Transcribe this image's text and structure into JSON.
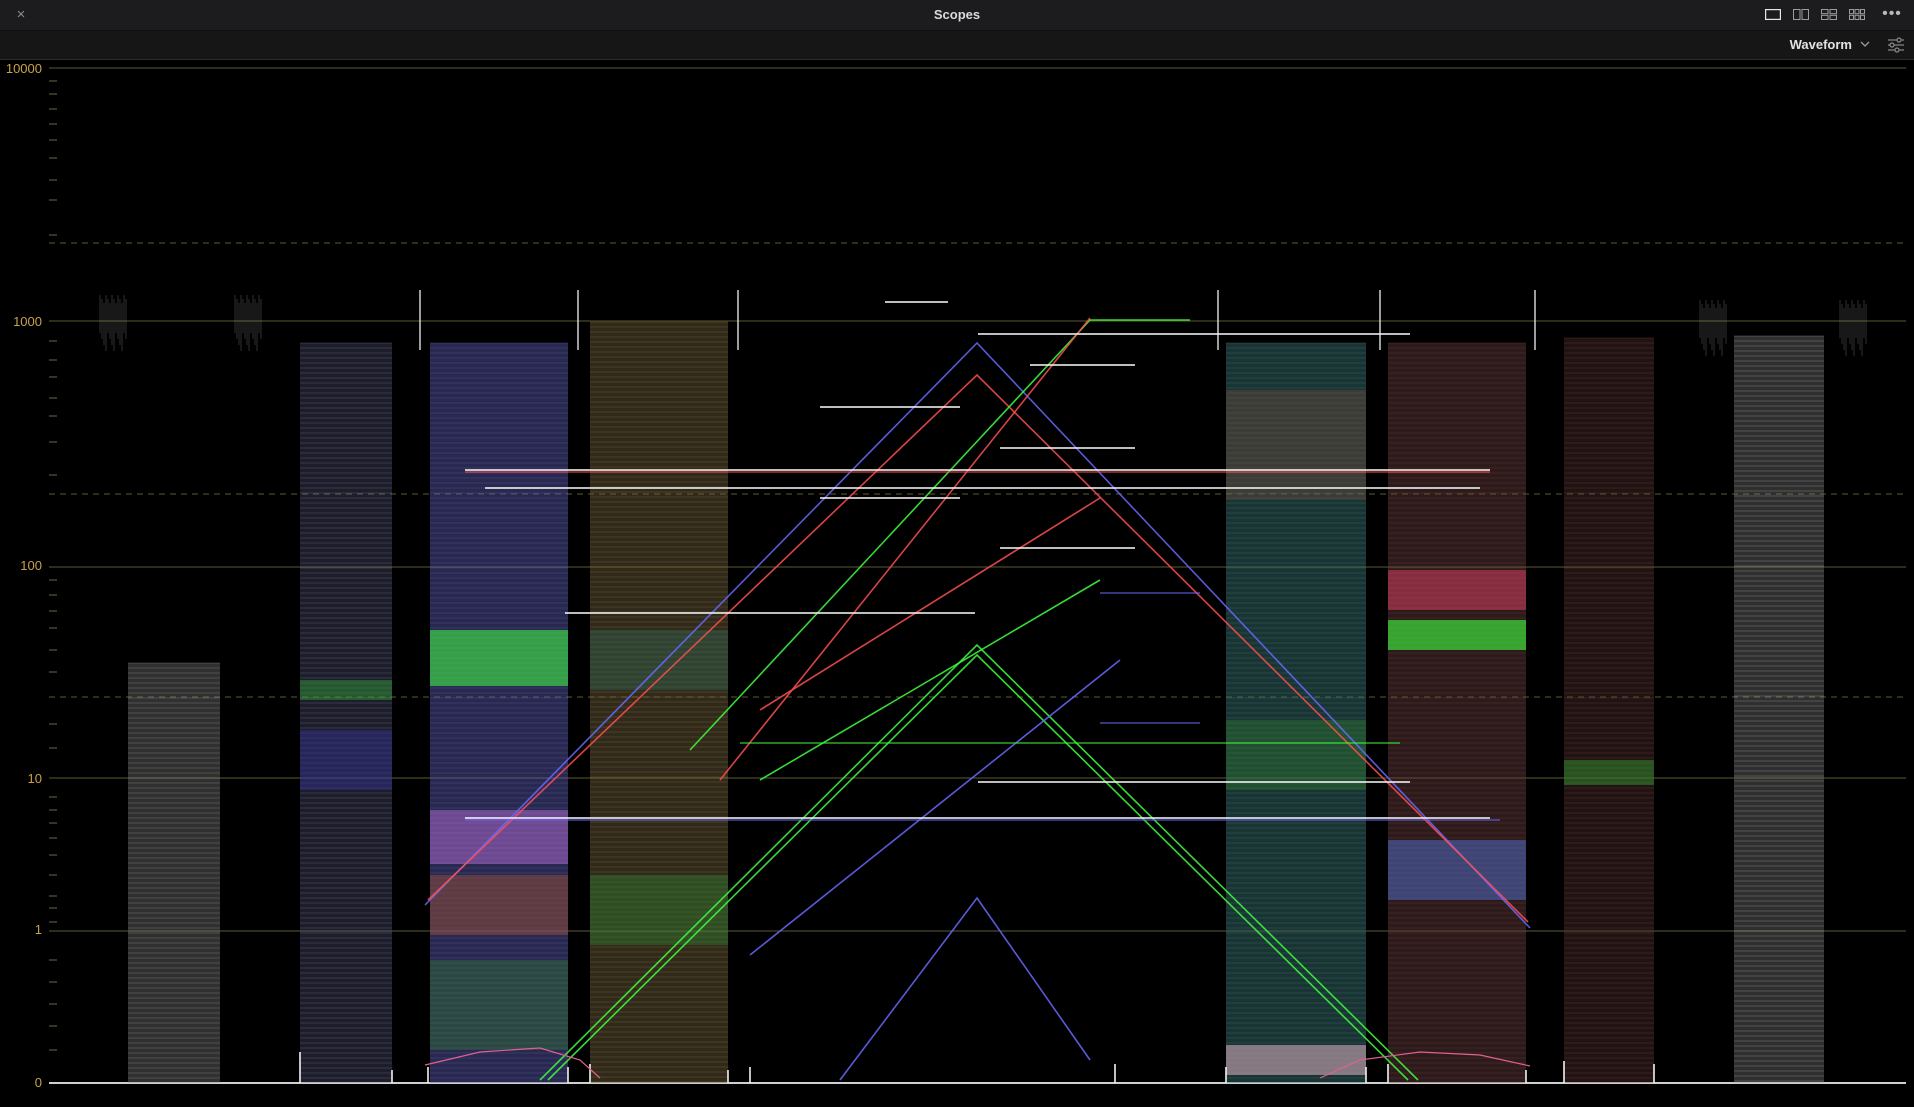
{
  "window": {
    "title": "Scopes",
    "close_glyph": "×",
    "more_glyph": "•••",
    "layout_buttons": [
      {
        "name": "layout-single-icon"
      },
      {
        "name": "layout-dual-icon"
      },
      {
        "name": "layout-quad-icon"
      },
      {
        "name": "layout-grid-icon"
      }
    ]
  },
  "toolbar": {
    "scope_type": "Waveform",
    "dropdown_icon": "chevron-down-icon",
    "settings_icon": "sliders-icon"
  },
  "scope": {
    "axis_labels": [
      "10000",
      "1000",
      "100",
      "10",
      "1",
      "0"
    ],
    "label_color": "#c9a24a",
    "graticule_color": "#5b5a2e",
    "colors": {
      "red": "#ff5050",
      "green": "#40ff40",
      "blue": "#6a6aff",
      "white": "#f2f2f2"
    }
  }
}
